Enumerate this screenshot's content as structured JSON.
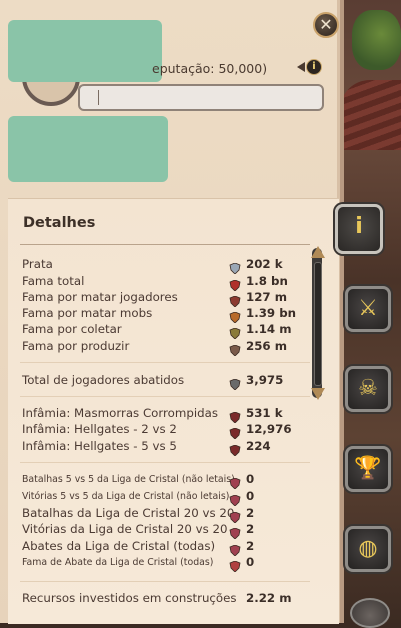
{
  "header": {
    "close_icon": "close-icon",
    "reputation_text": "eputação: 50,000)",
    "motto_placeholder": ""
  },
  "details": {
    "title": "Detalhes",
    "rows": [
      {
        "label": "Prata",
        "icon": "silver-icon",
        "value": "202 k",
        "small": false
      },
      {
        "label": "Fama total",
        "icon": "fame-icon",
        "value": "1.8 bn",
        "small": false
      },
      {
        "label": "Fama por matar jogadores",
        "icon": "pvp-fame-icon",
        "value": "127 m",
        "small": false
      },
      {
        "label": "Fama por matar mobs",
        "icon": "pve-fame-icon",
        "value": "1.39 bn",
        "small": false
      },
      {
        "label": "Fama por coletar",
        "icon": "gathering-fame-icon",
        "value": "1.14 m",
        "small": false
      },
      {
        "label": "Fama por produzir",
        "icon": "crafting-fame-icon",
        "value": "256 m",
        "small": false
      },
      {
        "label": "Total de jogadores abatidos",
        "icon": "swords-icon",
        "value": "3,975",
        "small": false
      },
      {
        "label": "Infâmia: Masmorras Corrompidas",
        "icon": "infamy-icon",
        "value": "531 k",
        "small": false
      },
      {
        "label": "Infâmia: Hellgates - 2 vs 2",
        "icon": "infamy-icon",
        "value": "12,976",
        "small": false
      },
      {
        "label": "Infâmia: Hellgates - 5 vs 5",
        "icon": "infamy-icon",
        "value": "224",
        "small": false
      },
      {
        "label": "Batalhas 5 vs 5 da Liga de Cristal (não letais)",
        "icon": "crystal-shield-icon",
        "value": "0",
        "small": true
      },
      {
        "label": "Vitórias 5 vs 5 da Liga de Cristal (não letais)",
        "icon": "crystal-shield-icon",
        "value": "0",
        "small": true
      },
      {
        "label": "Batalhas da Liga de Cristal 20 vs 20",
        "icon": "crystal-shield-icon",
        "value": "2",
        "small": false
      },
      {
        "label": "Vitórias da Liga de Cristal 20 vs 20",
        "icon": "crystal-shield-icon",
        "value": "2",
        "small": false
      },
      {
        "label": "Abates da Liga de Cristal (todas)",
        "icon": "crystal-shield-icon",
        "value": "2",
        "small": false
      },
      {
        "label": "Fama de Abate da Liga de Cristal (todas)",
        "icon": "crystal-fame-icon",
        "value": "0",
        "small": true
      },
      {
        "label": "Recursos investidos em construções",
        "icon": "",
        "value": "2.22 m",
        "small": false
      }
    ]
  },
  "tabs": [
    {
      "name": "tab-info",
      "icon": "info-icon",
      "glyph": "i",
      "active": true
    },
    {
      "name": "tab-combat",
      "icon": "crossed-swords-icon",
      "glyph": "⚔",
      "active": false
    },
    {
      "name": "tab-deaths",
      "icon": "skull-icon",
      "glyph": "☠",
      "active": false
    },
    {
      "name": "tab-achievements",
      "icon": "trophy-icon",
      "glyph": "🏆",
      "active": false
    },
    {
      "name": "tab-guild",
      "icon": "globe-icon",
      "glyph": "◍",
      "active": false
    }
  ]
}
